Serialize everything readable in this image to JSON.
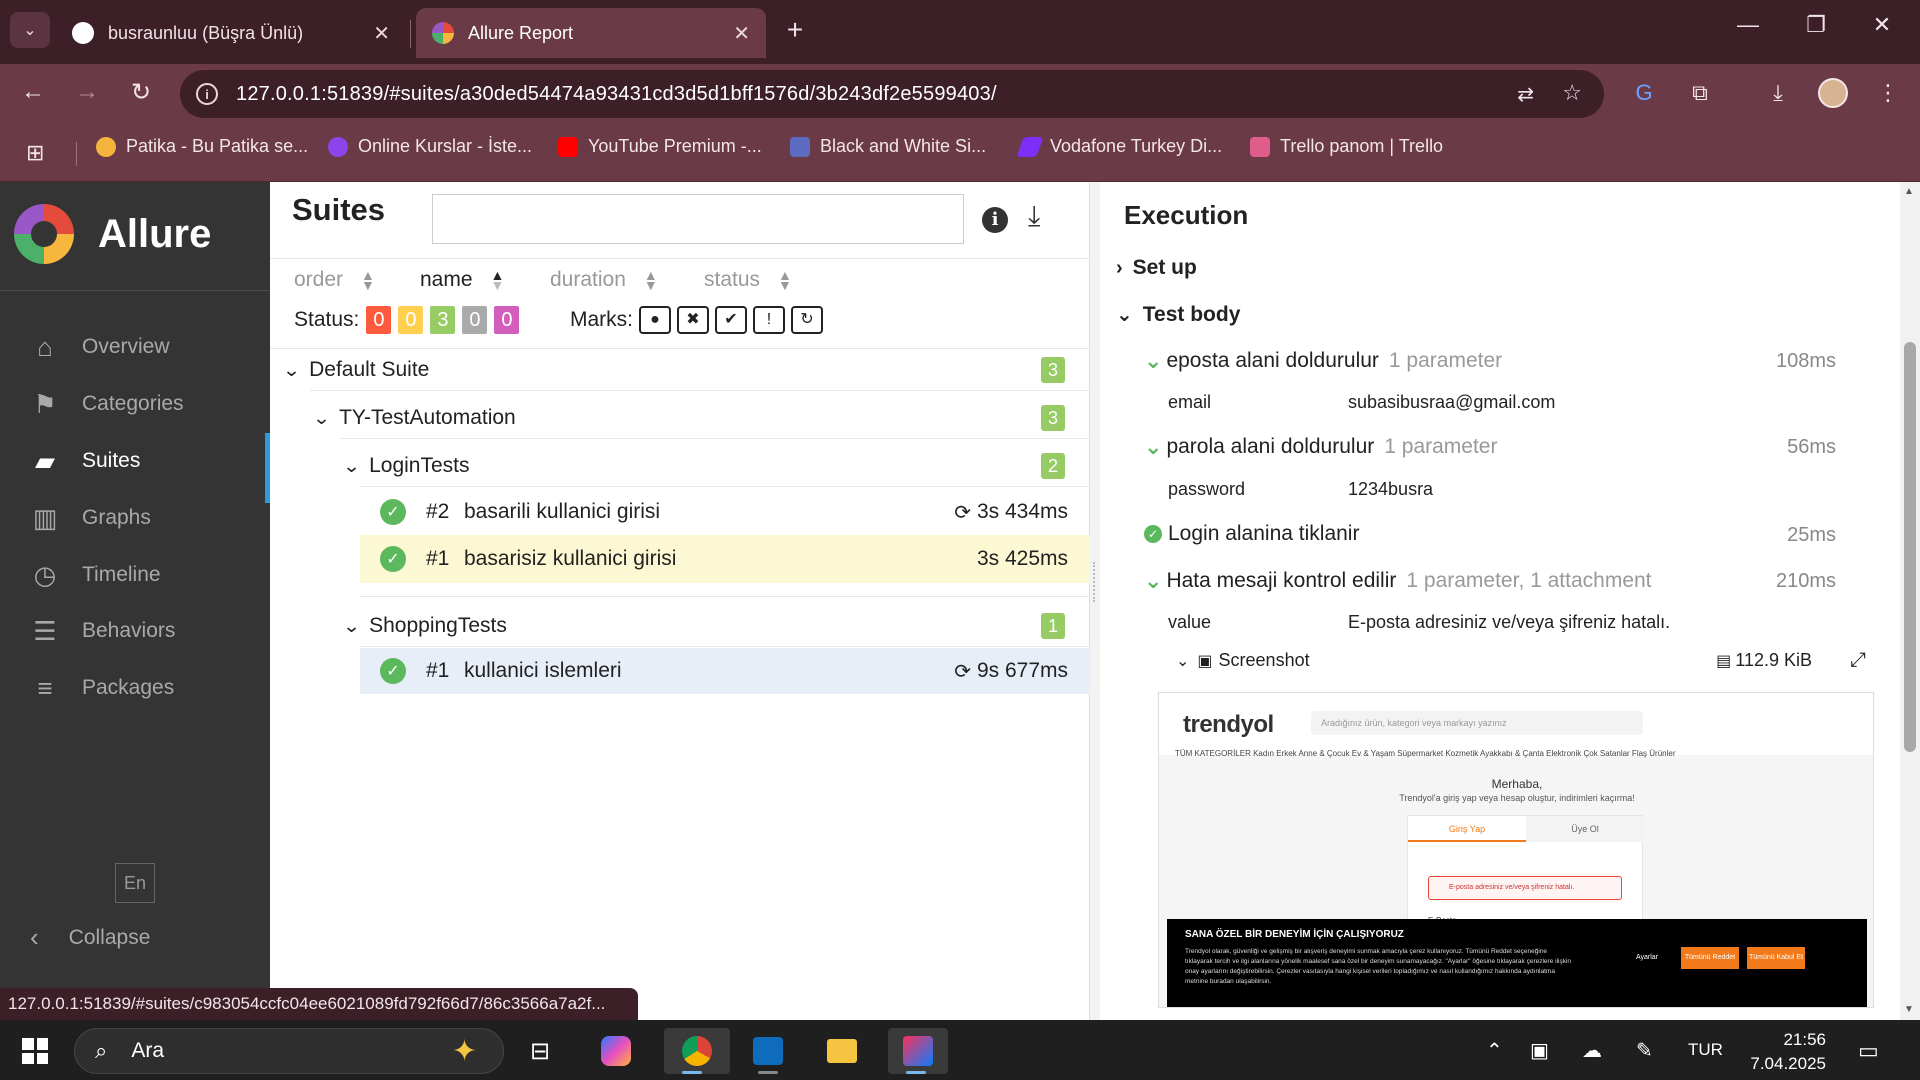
{
  "browser": {
    "tabs": [
      {
        "title": "busraunluu (Büşra Ünlü)",
        "icon": "github-icon"
      },
      {
        "title": "Allure Report",
        "icon": "allure-icon",
        "active": true
      }
    ],
    "url": "127.0.0.1:51839/#suites/a30ded54474a93431cd3d5d1bff1576d/3b243df2e5599403/",
    "bookmarks": [
      {
        "label": "Patika - Bu Patika se...",
        "color": "#f5b43c"
      },
      {
        "label": "Online Kurslar - İste...",
        "color": "#8e44ec"
      },
      {
        "label": "YouTube Premium -...",
        "color": "#ff0000"
      },
      {
        "label": "Black and White Si...",
        "color": "#5c6bc0"
      },
      {
        "label": "Vodafone Turkey Di...",
        "color": "#7b2ff7"
      },
      {
        "label": "Trello panom | Trello",
        "color": "#e05c8a"
      }
    ],
    "status_url": "127.0.0.1:51839/#suites/c983054ccfc04ee6021089fd792f66d7/86c3566a7a2f..."
  },
  "sidebar": {
    "brand": "Allure",
    "items": [
      {
        "label": "Overview",
        "icon": "home-icon"
      },
      {
        "label": "Categories",
        "icon": "flag-icon"
      },
      {
        "label": "Suites",
        "icon": "briefcase-icon",
        "active": true
      },
      {
        "label": "Graphs",
        "icon": "bar-chart-icon"
      },
      {
        "label": "Timeline",
        "icon": "clock-icon"
      },
      {
        "label": "Behaviors",
        "icon": "list-icon"
      },
      {
        "label": "Packages",
        "icon": "align-left-icon"
      }
    ],
    "lang": "En",
    "collapse": "Collapse"
  },
  "suites": {
    "title": "Suites",
    "sorters": [
      "order",
      "name",
      "duration",
      "status"
    ],
    "status_label": "Status:",
    "status_counts": [
      {
        "value": "0",
        "color": "#fd5a3e"
      },
      {
        "value": "0",
        "color": "#ffd050"
      },
      {
        "value": "3",
        "color": "#97cc64"
      },
      {
        "value": "0",
        "color": "#aaaaaa"
      },
      {
        "value": "0",
        "color": "#d35ebe"
      }
    ],
    "marks_label": "Marks:",
    "tree": {
      "root": {
        "name": "Default Suite",
        "count": "3"
      },
      "group": {
        "name": "TY-TestAutomation",
        "count": "3"
      },
      "login": {
        "name": "LoginTests",
        "count": "2"
      },
      "login_tests": [
        {
          "num": "#2",
          "name": "basarili kullanici girisi",
          "duration": "3s 434ms",
          "retry": true
        },
        {
          "num": "#1",
          "name": "basarisiz kullanici girisi",
          "duration": "3s 425ms",
          "retry": false
        }
      ],
      "shopping": {
        "name": "ShoppingTests",
        "count": "1"
      },
      "shopping_tests": [
        {
          "num": "#1",
          "name": "kullanici islemleri",
          "duration": "9s 677ms",
          "retry": true
        }
      ]
    }
  },
  "execution": {
    "title": "Execution",
    "setup": "Set up",
    "body": "Test body",
    "steps": [
      {
        "name": "eposta alani doldurulur",
        "meta": "1 parameter",
        "duration": "108ms",
        "param_name": "email",
        "param_value": "subasibusraa@gmail.com"
      },
      {
        "name": "parola alani doldurulur",
        "meta": "1 parameter",
        "duration": "56ms",
        "param_name": "password",
        "param_value": "1234busra"
      },
      {
        "name": "Login alanina tiklanir",
        "meta": "",
        "duration": "25ms"
      },
      {
        "name": "Hata mesaji kontrol edilir",
        "meta": "1 parameter, 1 attachment",
        "duration": "210ms",
        "param_name": "value",
        "param_value": "E-posta adresiniz ve/veya şifreniz hatalı."
      }
    ],
    "attachment": {
      "name": "Screenshot",
      "size": "112.9 KiB"
    },
    "screenshot": {
      "logo": "trendyol",
      "search": "Aradığınız ürün, kategori veya markayı yazınız",
      "categories": "TÜM KATEGORİLER   Kadın   Erkek   Anne & Çocuk   Ev & Yaşam   Süpermarket   Kozmetik   Ayakkabı & Çanta   Elektronik   Çok Satanlar   Flaş Ürünler",
      "hello": "Merhaba,",
      "sub": "Trendyol'a giriş yap veya hesap oluştur, indirimleri kaçırma!",
      "tab_login": "Giriş Yap",
      "tab_signup": "Üye Ol",
      "error": "E-posta adresiniz ve/veya şifreniz hatalı.",
      "email_label": "E-Posta",
      "cookie_title": "SANA ÖZEL BİR DENEYİM İÇİN ÇALIŞIYORUZ",
      "cookie_text": "Trendyol olarak, güvenliği ve gelişmiş bir alışveriş deneyimi sunmak amacıyla çerez kullanıyoruz. Tümünü Reddet seçeneğine tıklayarak tercih ve ilgi alanlarına yönelik maalesef sana özel bir deneyim sunamayacağız. \"Ayarlar\" öğesine tıklayarak çerezlere ilişkin onay ayarlarını değiştirebilirsin. Çerezler vasıtasıyla hangi kişisel verileri topladığımız ve nasıl kullandığımız hakkında aydınlatma metnine buradan ulaşabilirsin.",
      "settings": "Ayarlar",
      "reject": "Tümünü Reddet",
      "accept": "Tümünü Kabul Et"
    }
  },
  "taskbar": {
    "search": "Ara",
    "lang": "TUR",
    "time": "21:56",
    "date": "7.04.2025"
  }
}
